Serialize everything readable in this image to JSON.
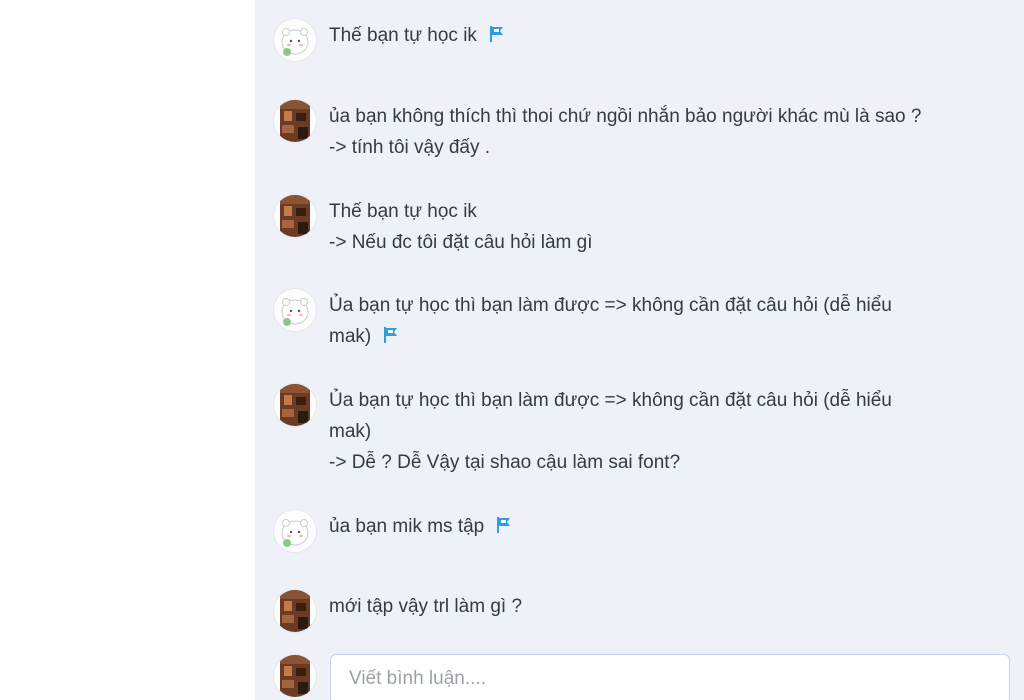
{
  "comments": [
    {
      "author": "bear",
      "lines": [
        "Thế bạn tự học ik"
      ],
      "flag": true
    },
    {
      "author": "photo",
      "lines": [
        "ủa bạn không thích thì thoi chứ ngồi nhắn bảo người khác mù là sao ?",
        "-> tính tôi vậy đấy ."
      ],
      "flag": false
    },
    {
      "author": "photo",
      "lines": [
        "Thế bạn tự học ik",
        "-> Nếu đc tôi đặt câu hỏi làm gì"
      ],
      "flag": false
    },
    {
      "author": "bear",
      "lines": [
        "Ủa bạn tự học thì bạn làm được => không cần đặt câu hỏi (dễ hiểu",
        "mak)"
      ],
      "flag": true
    },
    {
      "author": "photo",
      "lines": [
        "Ủa bạn tự học thì bạn làm được => không cần đặt câu hỏi (dễ hiểu",
        "mak)",
        "-> Dễ ? Dễ Vậy tại shao cậu làm sai font?"
      ],
      "flag": false
    },
    {
      "author": "bear",
      "lines": [
        "ủa bạn mik ms tập"
      ],
      "flag": true
    },
    {
      "author": "photo",
      "lines": [
        "mới tập vậy trl làm gì ?"
      ],
      "flag": false
    }
  ],
  "comment_input": {
    "placeholder": "Viết bình luận...."
  },
  "icons": {
    "flag": "flag-icon",
    "bear_avatar": "bear-avatar-icon",
    "photo_avatar": "user-photo-avatar"
  },
  "colors": {
    "flag": "#2d9ee0",
    "comment_bg": "#eef2f8",
    "text": "#333b45",
    "input_border": "#c6d3e4"
  }
}
